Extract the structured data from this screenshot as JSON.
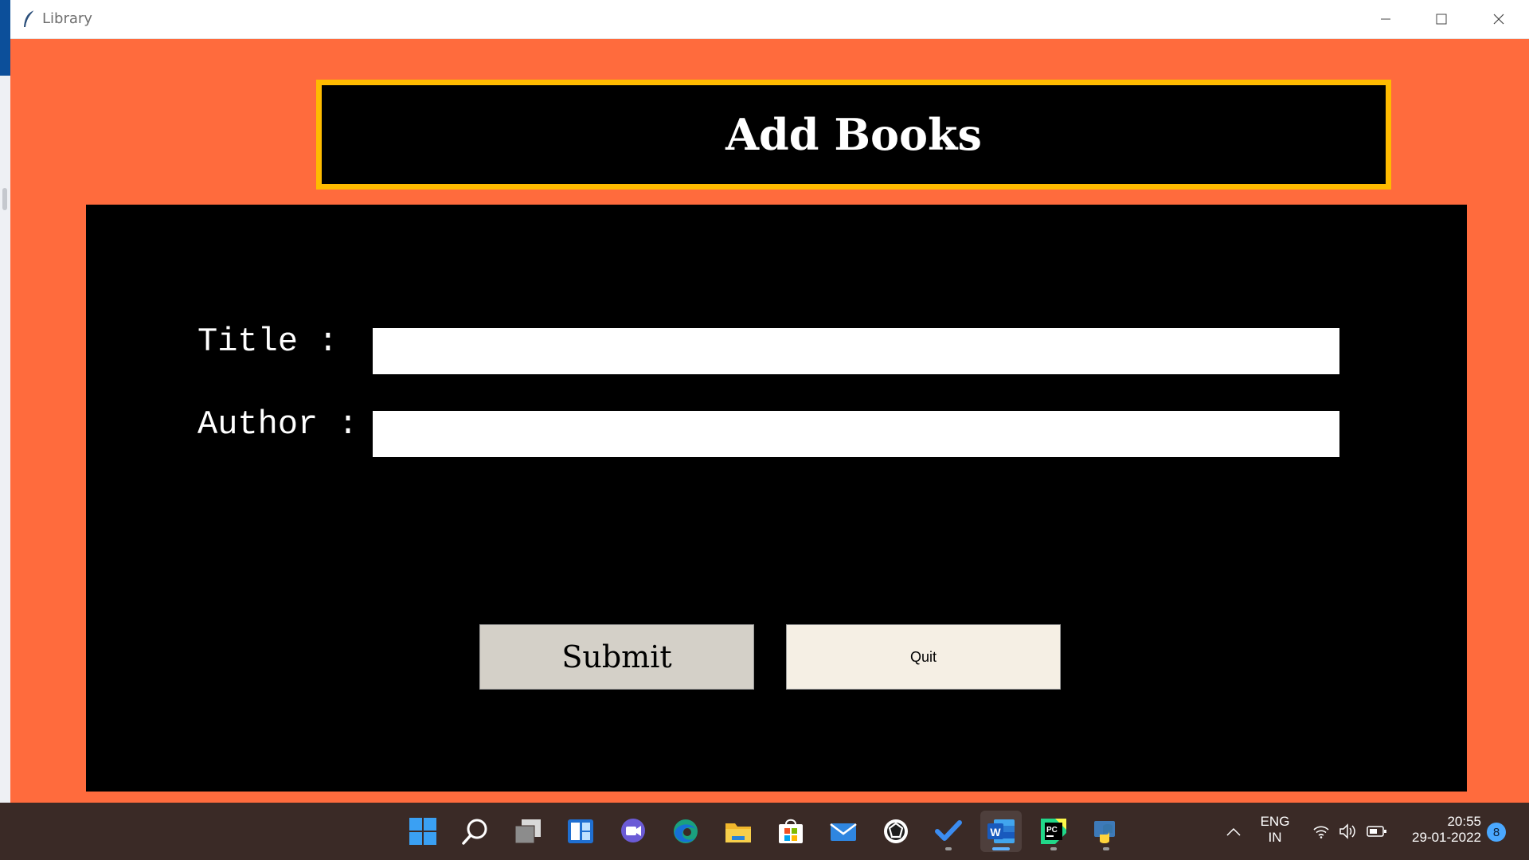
{
  "window": {
    "title": "Library",
    "minimize_icon": "minimize-icon",
    "maximize_icon": "maximize-icon",
    "close_icon": "close-icon"
  },
  "header": {
    "heading": "Add Books",
    "border_color": "#ffbb00",
    "background": "#000000"
  },
  "form": {
    "fields": [
      {
        "label": "Title :",
        "value": "",
        "placeholder": ""
      },
      {
        "label": "Author :",
        "value": "",
        "placeholder": ""
      }
    ],
    "submit_label": "Submit",
    "quit_label": "Quit"
  },
  "colors": {
    "window_background": "#ff6b3d",
    "panel_background": "#000000",
    "taskbar_background": "#3a2a26"
  },
  "taskbar": {
    "apps": [
      {
        "name": "windows-start-icon"
      },
      {
        "name": "search-icon"
      },
      {
        "name": "task-view-icon"
      },
      {
        "name": "widgets-icon"
      },
      {
        "name": "chat-icon"
      },
      {
        "name": "edge-icon"
      },
      {
        "name": "file-explorer-icon"
      },
      {
        "name": "store-icon"
      },
      {
        "name": "mail-icon"
      },
      {
        "name": "app-icon"
      },
      {
        "name": "todo-icon"
      },
      {
        "name": "word-icon"
      },
      {
        "name": "pycharm-icon"
      },
      {
        "name": "python-icon"
      }
    ],
    "tray": {
      "language_line1": "ENG",
      "language_line2": "IN",
      "time": "20:55",
      "date": "29-01-2022",
      "notifications": "8"
    }
  }
}
